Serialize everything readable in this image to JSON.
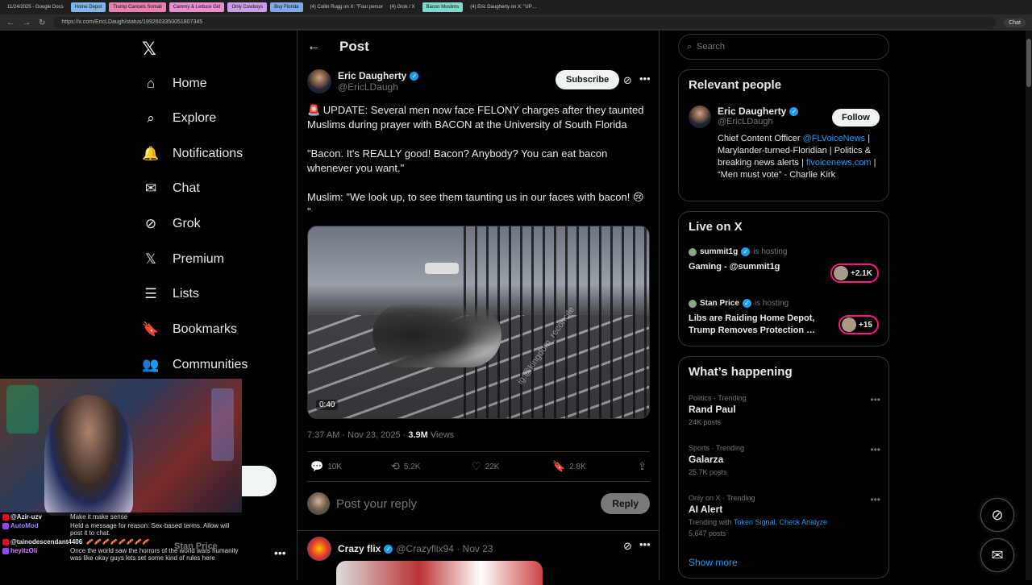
{
  "browser": {
    "tabs": [
      {
        "label": "11/24/2025 - Google Docs",
        "color": ""
      },
      {
        "label": "Home Depot",
        "color": "#7fb5e8"
      },
      {
        "label": "Trump Cancels Somali",
        "color": "#e87fb0"
      },
      {
        "label": "Cammy & Lettuce Girl",
        "color": "#e88fd0"
      },
      {
        "label": "Only Cowboys",
        "color": "#c89fe8"
      },
      {
        "label": "Buy Florida",
        "color": "#7fa8e8"
      },
      {
        "label": "(4) Collin Rugg on X: \"Four person…",
        "color": ""
      },
      {
        "label": "(4) Grok / X",
        "color": ""
      },
      {
        "label": "Bacon Muslims",
        "color": "#7fd8c8"
      },
      {
        "label": "(4) Eric Daugherty on X: \"UP…",
        "color": ""
      }
    ],
    "url": "https://x.com/EricLDaugh/status/1992603350051807345",
    "chat_label": "Chat"
  },
  "nav": {
    "items": [
      {
        "label": "Home",
        "icon": "⌂"
      },
      {
        "label": "Explore",
        "icon": "⌕"
      },
      {
        "label": "Notifications",
        "icon": "🔔",
        "badge": "4"
      },
      {
        "label": "Chat",
        "icon": "✉"
      },
      {
        "label": "Grok",
        "icon": "⊘"
      },
      {
        "label": "Premium",
        "icon": "𝕏"
      },
      {
        "label": "Lists",
        "icon": "☰"
      },
      {
        "label": "Bookmarks",
        "icon": "🔖"
      },
      {
        "label": "Communities",
        "icon": "👥"
      }
    ]
  },
  "stream_chat": [
    {
      "user": "@Azir-uzv",
      "msg": "Make it make sense",
      "color": "#e7e9ea",
      "badge": "#e02"
    },
    {
      "user": "AutoMod",
      "msg": "Held a message for reason: Sex-based terms. Allow will post it to chat.",
      "color": "#9f7fff",
      "badge": "#9147ff"
    },
    {
      "user": "@tainodescendant4406",
      "msg": "🥓🥓🥓🥓🥓🥓🥓🥓",
      "color": "#e7e9ea",
      "badge": "#e02"
    },
    {
      "user": "heyitzOli",
      "msg": "Once the world saw the horrors of the world wars humanity was like okay guys lets set some kind of rules here",
      "color": "#e080ff",
      "badge": "#9147ff"
    }
  ],
  "stream_ghost": "Stan Price",
  "header": {
    "back": "←",
    "title": "Post"
  },
  "post": {
    "author_name": "Eric Daugherty",
    "author_handle": "@EricLDaugh",
    "subscribe": "Subscribe",
    "p1": "🚨 UPDATE: Several men now face FELONY charges after they taunted Muslims during prayer with BACON at the University of South Florida",
    "p2": "\"Bacon. It's REALLY good! Bacon? Anybody? You can eat bacon whenever you want.\"",
    "p3": "Muslim: \"We look up, to see them taunting us in our faces with bacon! 😢\n\"",
    "video_watermark": "ig:@kingdom_reconcile",
    "duration": "0:40",
    "time": "7:37 AM · Nov 23, 2025 · ",
    "views": "3.9M",
    "views_label": " Views",
    "replies": "10K",
    "reposts": "5.2K",
    "likes": "22K",
    "bookmarks": "2.8K"
  },
  "reply": {
    "placeholder": "Post your reply",
    "button": "Reply"
  },
  "next_post": {
    "name": "Crazy flix",
    "handle": "@Crazyflix94 · Nov 23"
  },
  "search": {
    "placeholder": "Search"
  },
  "relevant": {
    "title": "Relevant people",
    "name": "Eric Daugherty",
    "handle": "@EricLDaugh",
    "follow": "Follow",
    "bio_a": "Chief Content Officer ",
    "bio_link1": "@FLVoiceNews",
    "bio_b": " | Marylander-turned-Floridian | Politics & breaking news alerts | ",
    "bio_link2": "flvoicenews.com",
    "bio_c": " | “Men must vote” - Charlie Kirk"
  },
  "live": {
    "title": "Live on X",
    "items": [
      {
        "host": "summit1g",
        "status": "is hosting",
        "title": "Gaming - @summit1g",
        "count": "+2.1K"
      },
      {
        "host": "Stan Price",
        "status": "is hosting",
        "title": "Libs are Raiding Home Depot, Trump Removes Protection …",
        "count": "+15"
      }
    ]
  },
  "happening": {
    "title": "What’s happening",
    "trends": [
      {
        "category": "Politics · Trending",
        "name": "Rand Paul",
        "count": "24K posts"
      },
      {
        "category": "Sports · Trending",
        "name": "Galarza",
        "count": "25.7K posts"
      },
      {
        "category": "Only on X · Trending",
        "name": "AI Alert",
        "with_label": "Trending with ",
        "with_links": "Token Signal, Check Analyze",
        "count": "5,647 posts"
      }
    ],
    "show_more": "Show more"
  }
}
